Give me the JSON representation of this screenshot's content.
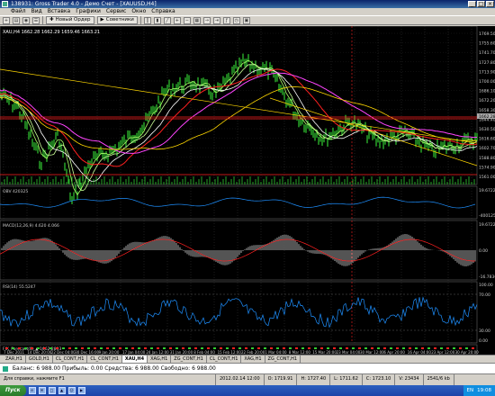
{
  "window": {
    "title": "138931: Gross Trader 4.0 - Демо Счет - [XAUUSD,H4]",
    "buttons": [
      "_",
      "□",
      "×"
    ]
  },
  "menu": [
    "Файл",
    "Вид",
    "Вставка",
    "Графики",
    "Сервис",
    "Окно",
    "Справка"
  ],
  "toolbar": {
    "new_order": "Новый Ордер",
    "experts": "Советники",
    "period_buttons": [
      "M1",
      "M5",
      "M15",
      "M30",
      "H1",
      "H4",
      "D1",
      "W1",
      "MN"
    ]
  },
  "chart": {
    "symbol_header": "XAU,H4 1662.28 1662.29 1659.46 1663.21",
    "price_ticks": [
      "1769.50",
      "1755.60",
      "1741.70",
      "1727.80",
      "1713.90",
      "1700.00",
      "1686.10",
      "1672.20",
      "1658.30",
      "1644.40",
      "1630.50",
      "1616.60",
      "1602.70",
      "1588.80",
      "1574.90",
      "1561.00"
    ],
    "current_price_label": "1662.28",
    "date_labels": [
      "7 Dec 2011",
      "14 Dec 20:00",
      "22 Dec 04:00",
      "30 Dec 16:00",
      "9 Jan 20:00",
      "17 Jan 04:00",
      "24 Jan 12:00",
      "31 Jan 20:00",
      "8 Feb 04:00",
      "15 Feb 12:00",
      "22 Feb 20:00",
      "1 Mar 04:00",
      "8 Mar 12:00",
      "15 Mar 20:00",
      "23 Mar 04:00",
      "30 Mar 12:00",
      "6 Apr 20:00",
      "16 Apr 04:00",
      "23 Apr 12:00",
      "30 Apr 20:00"
    ],
    "obv_label": "OBV 420325",
    "obv_ticks": [
      "19.6722",
      "",
      "-400125"
    ],
    "macd_label": "MACD(12,26,9) 4.620 4.066",
    "macd_ticks": [
      "19.6722",
      "0.00",
      "-16.7836"
    ],
    "rsi_label": "RSI(14) 55.5247",
    "rsi_ticks": [
      "100.00",
      "70.00",
      "30.00",
      "0.00"
    ],
    "bottom_indicator_label": "FIX_Forecast(8) ▲ 1662.2893"
  },
  "tabs": [
    {
      "label": "ZAR,H1",
      "active": false
    },
    {
      "label": "GOLD,H1",
      "active": false
    },
    {
      "label": "CL_CONT,H1",
      "active": false
    },
    {
      "label": "CL_CONT,H1",
      "active": false
    },
    {
      "label": "XAU,H4",
      "active": true
    },
    {
      "label": "XAG,H1",
      "active": false
    },
    {
      "label": "ZG_CONT,H1",
      "active": false
    },
    {
      "label": "CL_CONT,H1",
      "active": false
    },
    {
      "label": "XAG,H1",
      "active": false
    },
    {
      "label": "ZG_CONT,H1",
      "active": false
    }
  ],
  "terminal": {
    "balance_text": "Баланс: 6 988.00  Прибыль: 0.00  Средства: 6 988.00  Свободно: 6 988.00"
  },
  "statusbar": {
    "help": "Для справки, нажмите F1",
    "time": "2012.02.14 12:00",
    "open": "O: 1719.91",
    "high": "H: 1727.40",
    "low": "L: 1711.62",
    "close": "C: 1723.10",
    "volume": "V: 23434",
    "traffic": "2541/6 kb"
  },
  "taskbar": {
    "start": "Пуск",
    "lang": "EN",
    "clock": "19:08"
  },
  "colors": {
    "chart_bg": "#000000",
    "price_green": "#32cd32",
    "ma_yellow": "#ffd700",
    "ma_white": "#ffffff",
    "ma_magenta": "#ff44ff",
    "ma_red": "#ff2020",
    "osc_line": "#1e90ff"
  }
}
